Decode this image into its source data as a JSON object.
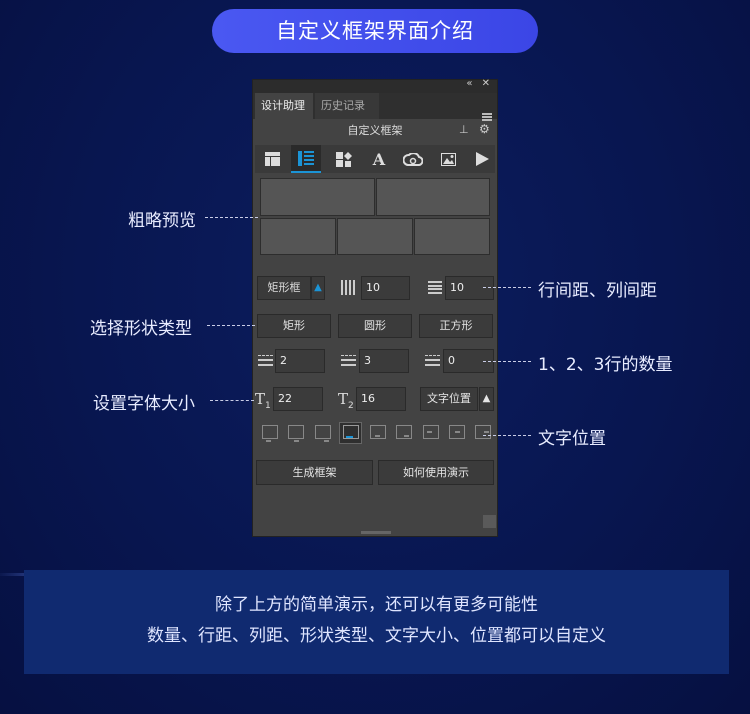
{
  "header": {
    "title": "自定义框架界面介绍"
  },
  "panel": {
    "tabs": [
      {
        "label": "设计助理",
        "active": true
      },
      {
        "label": "历史记录",
        "active": false
      }
    ],
    "title": "自定义框架",
    "toolbar_icons": [
      "layout-icon",
      "list-icon",
      "shapes-icon",
      "text-a-icon",
      "creative-cloud-icon",
      "image-icon",
      "play-icon"
    ],
    "shape_selector": {
      "label": "矩形框"
    },
    "row_spacing": "10",
    "col_spacing": "10",
    "shape_buttons": [
      "矩形",
      "圆形",
      "正方形"
    ],
    "counts": {
      "row1": "2",
      "row2": "3",
      "row3": "0"
    },
    "font_size": {
      "t1_label": "T",
      "t1_sub": "1",
      "t1_value": "22",
      "t2_label": "T",
      "t2_sub": "2",
      "t2_value": "16"
    },
    "text_position_label": "文字位置",
    "actions": {
      "generate": "生成框架",
      "howto": "如何使用演示"
    },
    "accent_color": "#1b94d6"
  },
  "annotations": {
    "preview": "粗略预览",
    "shape_type": "选择形状类型",
    "font_size": "设置字体大小",
    "spacing": "行间距、列间距",
    "row_count": "1、2、3行的数量",
    "text_position": "文字位置"
  },
  "info": {
    "line1": "除了上方的简单演示，还可以有更多可能性",
    "line2": "数量、行距、列距、形状类型、文字大小、位置都可以自定义"
  },
  "colors": {
    "background": "#081650",
    "pill": "#4a58f2",
    "panel": "#434343",
    "info_box": "#102a70"
  }
}
